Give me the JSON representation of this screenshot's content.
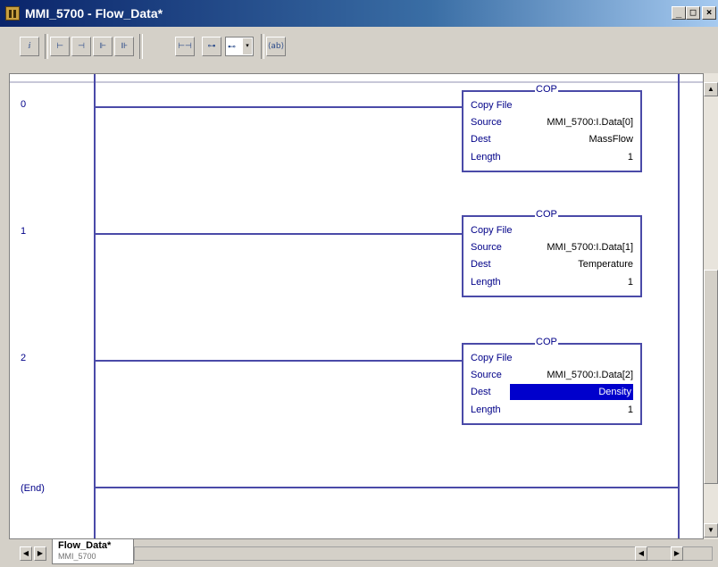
{
  "window": {
    "title": "MMI_5700 - Flow_Data*",
    "min_label": "_",
    "max_label": "□",
    "close_label": "×"
  },
  "toolbar": {
    "buttons": [
      "ⅈ",
      "⊢",
      "⊣",
      "⊩",
      "⊪"
    ],
    "branch_wide_1": "⊢⊣",
    "branch_wide_2": "⊶",
    "dropdown_label": "⊷",
    "dropdown_arrow": "▾",
    "tag_button": "⟨ab⟩"
  },
  "rungs": [
    {
      "number": "0",
      "instruction": "COP",
      "desc": "Copy File",
      "source_label": "Source",
      "source": "MMI_5700:I.Data[0]",
      "dest_label": "Dest",
      "dest": "MassFlow",
      "length_label": "Length",
      "length": "1"
    },
    {
      "number": "1",
      "instruction": "COP",
      "desc": "Copy File",
      "source_label": "Source",
      "source": "MMI_5700:I.Data[1]",
      "dest_label": "Dest",
      "dest": "Temperature",
      "length_label": "Length",
      "length": "1"
    },
    {
      "number": "2",
      "instruction": "COP",
      "desc": "Copy File",
      "source_label": "Source",
      "source": "MMI_5700:I.Data[2]",
      "dest_label": "Dest",
      "dest": "Density",
      "length_label": "Length",
      "length": "1"
    }
  ],
  "end_label": "(End)",
  "bottom": {
    "tab_label": "Flow_Data*",
    "tab_sub": "MMI_5700"
  }
}
